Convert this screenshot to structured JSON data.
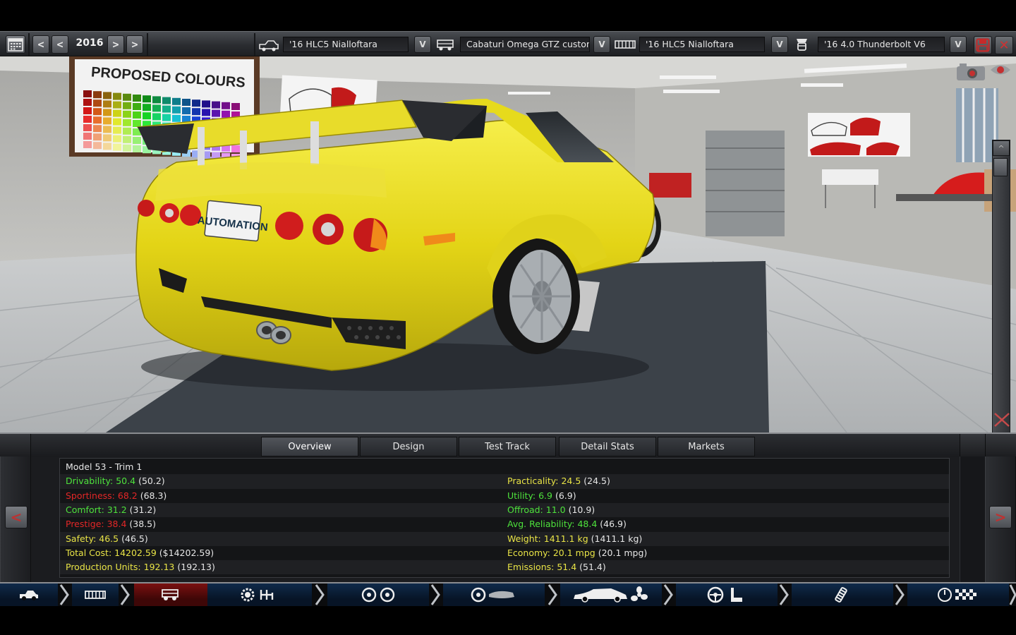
{
  "topbar": {
    "year": "2016",
    "prev_fast": "<",
    "prev": "<",
    "next": ">",
    "next_fast": ">",
    "model_field": "'16    HLC5 Nialloftara",
    "body_field": "Cabaturi Omega GTZ custom",
    "trim_field": "'16    HLC5 Nialloftara",
    "engine_field": "'16 4.0 Thunderbolt V6",
    "dropdown_label": "V",
    "close_label": "✕"
  },
  "tabs": [
    {
      "label": "Overview",
      "active": true
    },
    {
      "label": "Design",
      "active": false
    },
    {
      "label": "Test Track",
      "active": false
    },
    {
      "label": "Detail Stats",
      "active": false
    },
    {
      "label": "Markets",
      "active": false
    }
  ],
  "stats": {
    "title": "Model 53 - Trim 1",
    "left": [
      {
        "label": "Drivability:",
        "value": "50.4",
        "ref": "(50.2)",
        "color": "g"
      },
      {
        "label": "Sportiness:",
        "value": "68.2",
        "ref": "(68.3)",
        "color": "r"
      },
      {
        "label": "Comfort:",
        "value": "31.2",
        "ref": "(31.2)",
        "color": "g"
      },
      {
        "label": "Prestige:",
        "value": "38.4",
        "ref": "(38.5)",
        "color": "r"
      },
      {
        "label": "Safety:",
        "value": "46.5",
        "ref": "(46.5)",
        "color": "y"
      },
      {
        "label": "Total Cost:",
        "value": "14202.59",
        "ref": "($14202.59)",
        "color": "y"
      },
      {
        "label": "Production Units:",
        "value": "192.13",
        "ref": "(192.13)",
        "color": "y"
      }
    ],
    "right": [
      {
        "label": "Practicality:",
        "value": "24.5",
        "ref": "(24.5)",
        "color": "y"
      },
      {
        "label": "Utility:",
        "value": "6.9",
        "ref": "(6.9)",
        "color": "g"
      },
      {
        "label": "Offroad:",
        "value": "11.0",
        "ref": "(10.9)",
        "color": "g"
      },
      {
        "label": "Avg. Reliability:",
        "value": "48.4",
        "ref": "(46.9)",
        "color": "g"
      },
      {
        "label": "Weight:",
        "value": "1411.1 kg",
        "ref": "(1411.1 kg)",
        "color": "y"
      },
      {
        "label": "Economy:",
        "value": "20.1 mpg",
        "ref": "(20.1 mpg)",
        "color": "y"
      },
      {
        "label": "Emissions:",
        "value": "51.4",
        "ref": "(51.4)",
        "color": "y"
      }
    ]
  },
  "scene": {
    "poster_title": "PROPOSED COLOURS",
    "plate_text": "AUTOMATION"
  },
  "side_nav": {
    "left": "<",
    "right": ">"
  },
  "scroll": {
    "up": "^",
    "down": "v"
  },
  "colors": {
    "accent_red": "#e32727",
    "green": "#4ee23c",
    "yellow": "#e8e346",
    "car_yellow": "#e8dc18",
    "nav_blue": "#0f2a4a",
    "nav_active": "#7a1010"
  },
  "bottom_nav": [
    {
      "icon": "car-side-icon",
      "active": false
    },
    {
      "icon": "chassis-icon",
      "active": false
    },
    {
      "icon": "car-body-icon",
      "active": true
    },
    {
      "icon": "engine-gearbox-icon",
      "active": false
    },
    {
      "icon": "wheels-icon",
      "active": false
    },
    {
      "icon": "suspension-icon",
      "active": false
    },
    {
      "icon": "car-aero-icon",
      "active": false
    },
    {
      "icon": "interior-icon",
      "active": false
    },
    {
      "icon": "tuning-icon",
      "active": false
    },
    {
      "icon": "test-track-icon",
      "active": false
    }
  ]
}
